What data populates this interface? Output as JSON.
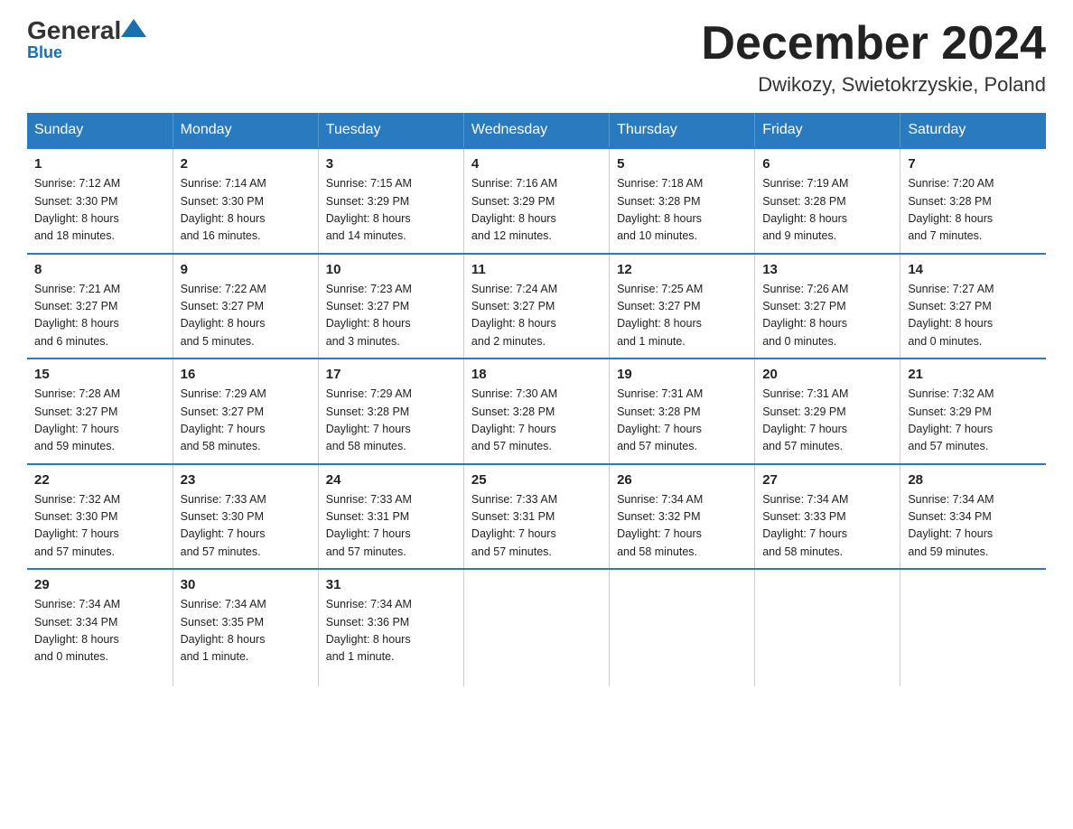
{
  "header": {
    "logo_general": "General",
    "logo_blue": "Blue",
    "title": "December 2024",
    "subtitle": "Dwikozy, Swietokrzyskie, Poland"
  },
  "days_of_week": [
    "Sunday",
    "Monday",
    "Tuesday",
    "Wednesday",
    "Thursday",
    "Friday",
    "Saturday"
  ],
  "weeks": [
    [
      {
        "day": "1",
        "info": "Sunrise: 7:12 AM\nSunset: 3:30 PM\nDaylight: 8 hours\nand 18 minutes."
      },
      {
        "day": "2",
        "info": "Sunrise: 7:14 AM\nSunset: 3:30 PM\nDaylight: 8 hours\nand 16 minutes."
      },
      {
        "day": "3",
        "info": "Sunrise: 7:15 AM\nSunset: 3:29 PM\nDaylight: 8 hours\nand 14 minutes."
      },
      {
        "day": "4",
        "info": "Sunrise: 7:16 AM\nSunset: 3:29 PM\nDaylight: 8 hours\nand 12 minutes."
      },
      {
        "day": "5",
        "info": "Sunrise: 7:18 AM\nSunset: 3:28 PM\nDaylight: 8 hours\nand 10 minutes."
      },
      {
        "day": "6",
        "info": "Sunrise: 7:19 AM\nSunset: 3:28 PM\nDaylight: 8 hours\nand 9 minutes."
      },
      {
        "day": "7",
        "info": "Sunrise: 7:20 AM\nSunset: 3:28 PM\nDaylight: 8 hours\nand 7 minutes."
      }
    ],
    [
      {
        "day": "8",
        "info": "Sunrise: 7:21 AM\nSunset: 3:27 PM\nDaylight: 8 hours\nand 6 minutes."
      },
      {
        "day": "9",
        "info": "Sunrise: 7:22 AM\nSunset: 3:27 PM\nDaylight: 8 hours\nand 5 minutes."
      },
      {
        "day": "10",
        "info": "Sunrise: 7:23 AM\nSunset: 3:27 PM\nDaylight: 8 hours\nand 3 minutes."
      },
      {
        "day": "11",
        "info": "Sunrise: 7:24 AM\nSunset: 3:27 PM\nDaylight: 8 hours\nand 2 minutes."
      },
      {
        "day": "12",
        "info": "Sunrise: 7:25 AM\nSunset: 3:27 PM\nDaylight: 8 hours\nand 1 minute."
      },
      {
        "day": "13",
        "info": "Sunrise: 7:26 AM\nSunset: 3:27 PM\nDaylight: 8 hours\nand 0 minutes."
      },
      {
        "day": "14",
        "info": "Sunrise: 7:27 AM\nSunset: 3:27 PM\nDaylight: 8 hours\nand 0 minutes."
      }
    ],
    [
      {
        "day": "15",
        "info": "Sunrise: 7:28 AM\nSunset: 3:27 PM\nDaylight: 7 hours\nand 59 minutes."
      },
      {
        "day": "16",
        "info": "Sunrise: 7:29 AM\nSunset: 3:27 PM\nDaylight: 7 hours\nand 58 minutes."
      },
      {
        "day": "17",
        "info": "Sunrise: 7:29 AM\nSunset: 3:28 PM\nDaylight: 7 hours\nand 58 minutes."
      },
      {
        "day": "18",
        "info": "Sunrise: 7:30 AM\nSunset: 3:28 PM\nDaylight: 7 hours\nand 57 minutes."
      },
      {
        "day": "19",
        "info": "Sunrise: 7:31 AM\nSunset: 3:28 PM\nDaylight: 7 hours\nand 57 minutes."
      },
      {
        "day": "20",
        "info": "Sunrise: 7:31 AM\nSunset: 3:29 PM\nDaylight: 7 hours\nand 57 minutes."
      },
      {
        "day": "21",
        "info": "Sunrise: 7:32 AM\nSunset: 3:29 PM\nDaylight: 7 hours\nand 57 minutes."
      }
    ],
    [
      {
        "day": "22",
        "info": "Sunrise: 7:32 AM\nSunset: 3:30 PM\nDaylight: 7 hours\nand 57 minutes."
      },
      {
        "day": "23",
        "info": "Sunrise: 7:33 AM\nSunset: 3:30 PM\nDaylight: 7 hours\nand 57 minutes."
      },
      {
        "day": "24",
        "info": "Sunrise: 7:33 AM\nSunset: 3:31 PM\nDaylight: 7 hours\nand 57 minutes."
      },
      {
        "day": "25",
        "info": "Sunrise: 7:33 AM\nSunset: 3:31 PM\nDaylight: 7 hours\nand 57 minutes."
      },
      {
        "day": "26",
        "info": "Sunrise: 7:34 AM\nSunset: 3:32 PM\nDaylight: 7 hours\nand 58 minutes."
      },
      {
        "day": "27",
        "info": "Sunrise: 7:34 AM\nSunset: 3:33 PM\nDaylight: 7 hours\nand 58 minutes."
      },
      {
        "day": "28",
        "info": "Sunrise: 7:34 AM\nSunset: 3:34 PM\nDaylight: 7 hours\nand 59 minutes."
      }
    ],
    [
      {
        "day": "29",
        "info": "Sunrise: 7:34 AM\nSunset: 3:34 PM\nDaylight: 8 hours\nand 0 minutes."
      },
      {
        "day": "30",
        "info": "Sunrise: 7:34 AM\nSunset: 3:35 PM\nDaylight: 8 hours\nand 1 minute."
      },
      {
        "day": "31",
        "info": "Sunrise: 7:34 AM\nSunset: 3:36 PM\nDaylight: 8 hours\nand 1 minute."
      },
      {
        "day": "",
        "info": ""
      },
      {
        "day": "",
        "info": ""
      },
      {
        "day": "",
        "info": ""
      },
      {
        "day": "",
        "info": ""
      }
    ]
  ]
}
